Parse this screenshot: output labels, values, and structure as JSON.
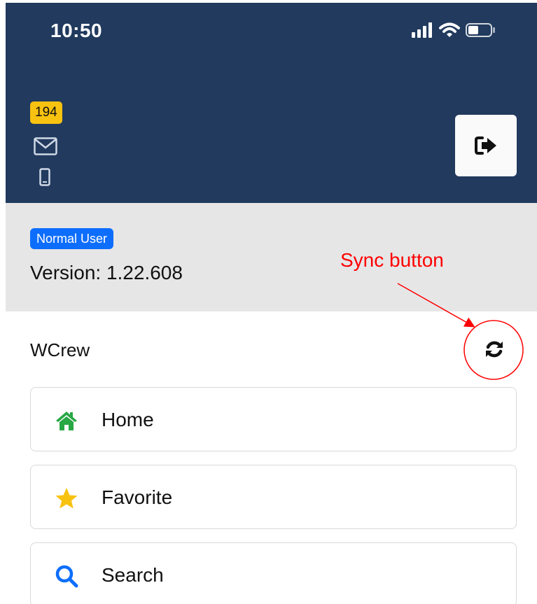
{
  "status_bar": {
    "time": "10:50"
  },
  "header": {
    "notification_count": "194",
    "mail_icon": "envelope-icon",
    "phone_icon": "mobile-phone-icon",
    "logout_icon": "sign-out-icon",
    "background_color": "#213a5e"
  },
  "user_info": {
    "role_badge": "Normal User",
    "version": "Version: 1.22.608",
    "band_color": "#e6e6e7"
  },
  "annotation": {
    "label": "Sync button",
    "color": "#ff0000"
  },
  "section": {
    "title": "WCrew",
    "sync_icon": "refresh-icon"
  },
  "menu": [
    {
      "label": "Home",
      "icon": "home-icon",
      "icon_color": "#28a745"
    },
    {
      "label": "Favorite",
      "icon": "star-icon",
      "icon_color": "#f8c211"
    },
    {
      "label": "Search",
      "icon": "search-icon",
      "icon_color": "#0d6efd"
    }
  ]
}
